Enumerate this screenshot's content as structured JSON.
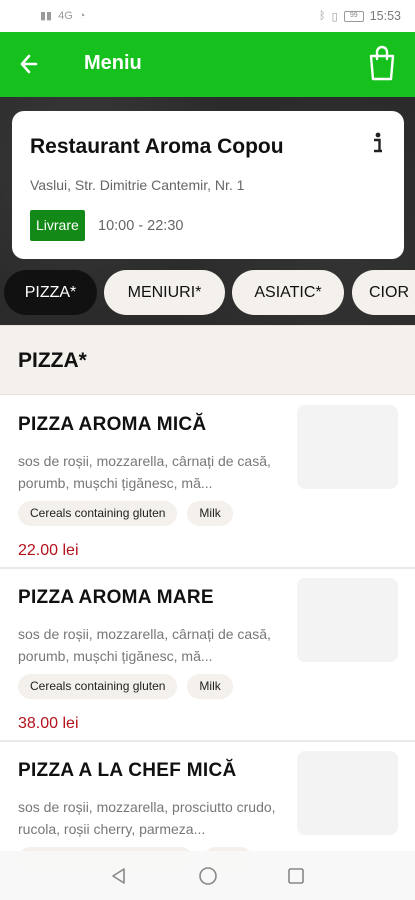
{
  "status_bar": {
    "time": "15:53",
    "signal": "4G",
    "battery": "99"
  },
  "app_bar": {
    "title": "Meniu"
  },
  "restaurant": {
    "name": "Restaurant Aroma Copou",
    "address": "Vaslui, Str. Dimitrie Cantemir, Nr. 1",
    "delivery_badge": "Livrare",
    "hours": "10:00 - 22:30"
  },
  "tabs": [
    {
      "label": "PIZZA*",
      "active": true
    },
    {
      "label": "MENIURI*",
      "active": false
    },
    {
      "label": "ASIATIC*",
      "active": false
    },
    {
      "label": "CIOR",
      "active": false
    }
  ],
  "section": {
    "title": "PIZZA*"
  },
  "items": [
    {
      "name": "PIZZA AROMA MICĂ",
      "description": "sos de roșii, mozzarella, cârnați de casă, porumb, mușchi țigănesc, mă...",
      "allergens": [
        "Cereals containing gluten",
        "Milk"
      ],
      "price": "22.00 lei"
    },
    {
      "name": "PIZZA AROMA MARE",
      "description": "sos de roșii, mozzarella, cârnați de casă, porumb, mușchi țigănesc, mă...",
      "allergens": [
        "Cereals containing gluten",
        "Milk"
      ],
      "price": "38.00 lei"
    },
    {
      "name": "PIZZA A LA CHEF MICĂ",
      "description": "sos de roșii, mozzarella, prosciutto crudo, rucola, roșii cherry, parmeza...",
      "allergens": [
        "",
        ""
      ],
      "price": ""
    }
  ],
  "colors": {
    "accent": "#17c11d",
    "badge": "#138a17",
    "price": "#b5121b",
    "chip": "#f4f1ec"
  },
  "icons": {
    "back": "arrow-left-icon",
    "cart": "shopping-bag-icon",
    "info": "info-icon"
  }
}
